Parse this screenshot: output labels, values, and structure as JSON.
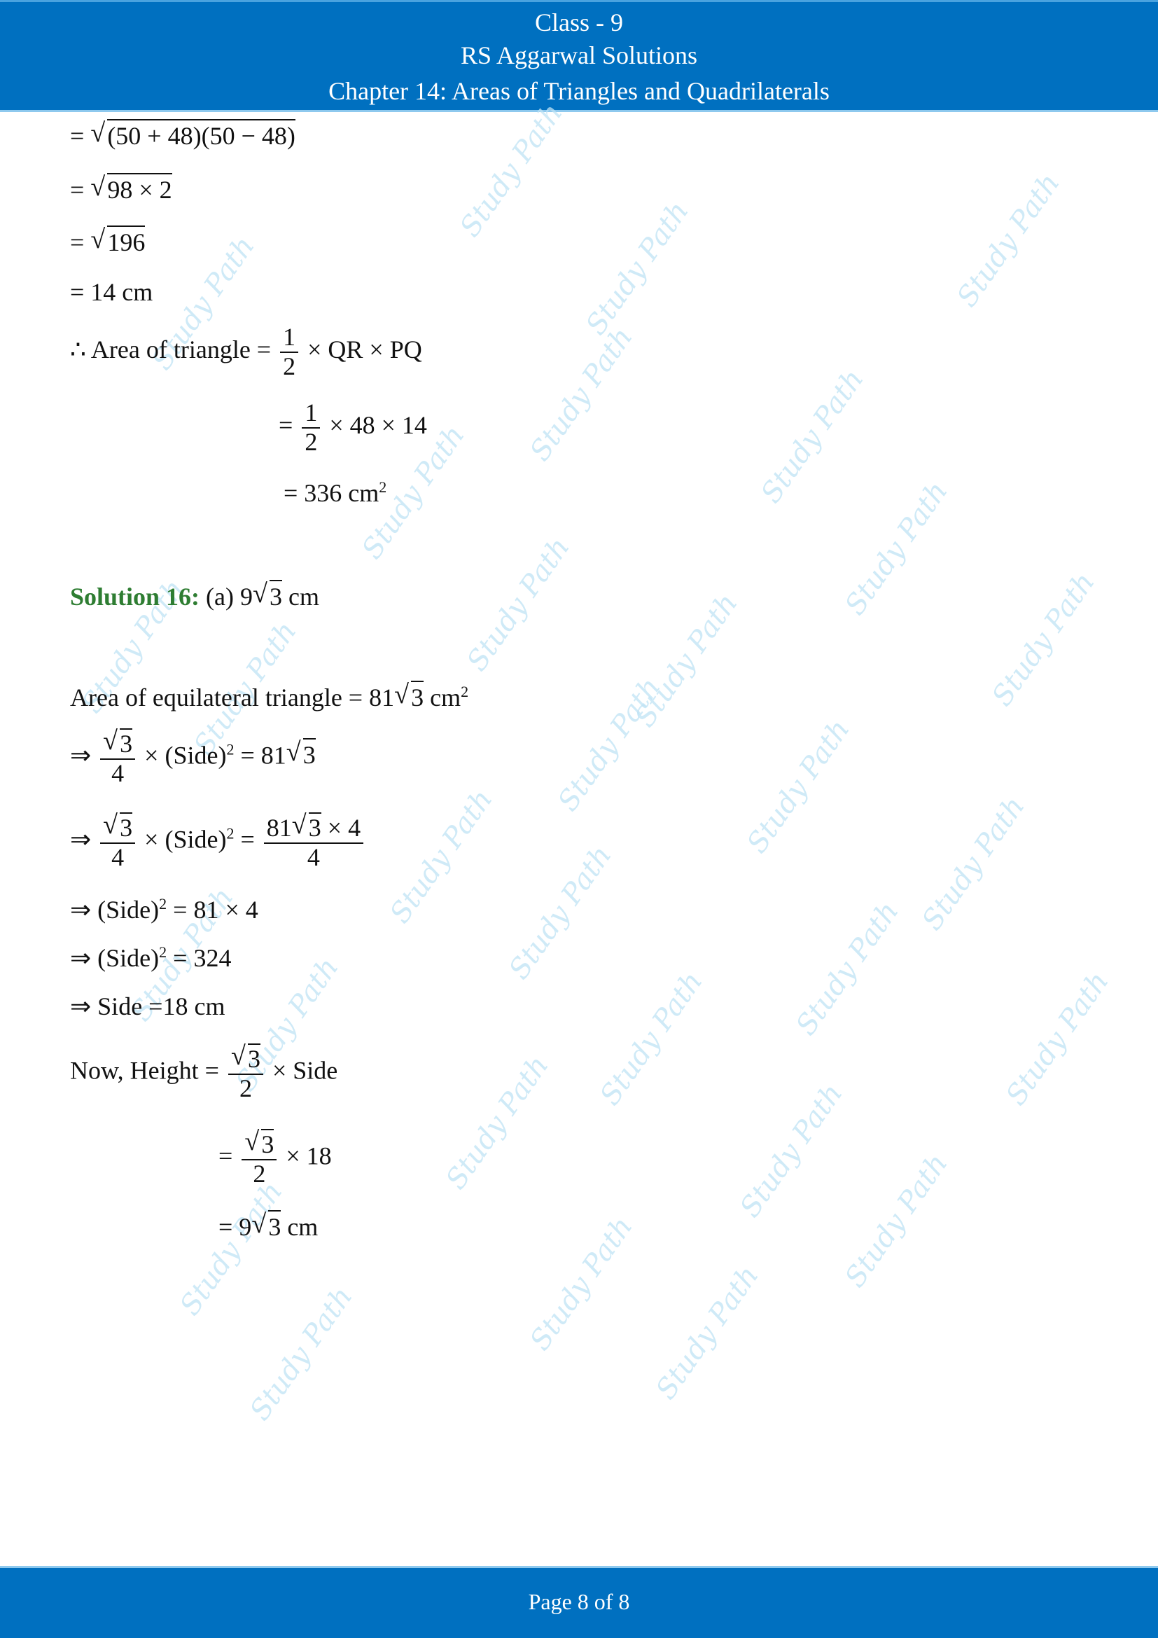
{
  "header": {
    "line1": "Class - 9",
    "line2": "RS Aggarwal Solutions",
    "line3": "Chapter 14: Areas of Triangles and Quadrilaterals"
  },
  "colors": {
    "brand": "#0070c0",
    "solution_label": "#2e7d32",
    "watermark": "#bfe3f5"
  },
  "watermark_text": "Study Path",
  "content": {
    "l1_eq": "=",
    "l1_rad": "(50 + 48)(50 − 48)",
    "l2_eq": "=",
    "l2_rad": "98 × 2",
    "l3_eq": "=",
    "l3_rad": "196",
    "l4": "= 14 cm",
    "area_prefix": "∴ Area of triangle =",
    "half_num": "1",
    "half_den": "2",
    "area_tail": "× QR × PQ",
    "area2_eq": "=",
    "area2_tail": "× 48 × 14",
    "area3": "= 336 cm",
    "area3_sup": "2",
    "solution_label": "Solution 16:",
    "solution_answer_a": "(a) 9",
    "solution_answer_rad": "3",
    "solution_answer_unit": "cm",
    "eq_area_prefix": "Area of equilateral triangle = 81",
    "eq_area_rad": "3",
    "eq_area_unit": "cm",
    "eq_area_sup": "2",
    "s1_arrow": "⇒",
    "s1_num_rad": "3",
    "s1_den": "4",
    "s1_mid": "× (Side)",
    "s1_sup": "2",
    "s1_rhs": "= 81",
    "s1_rhs_rad": "3",
    "s2_arrow": "⇒",
    "s2_num_rad": "3",
    "s2_den": "4",
    "s2_mid": "× (Side)",
    "s2_sup": "2",
    "s2_eq": "=",
    "s2_rhs_num_pre": "81",
    "s2_rhs_num_rad": "3",
    "s2_rhs_num_post": "× 4",
    "s2_rhs_den": "4",
    "s3": "⇒ (Side)",
    "s3_sup": "2",
    "s3_tail": "= 81 × 4",
    "s4": "⇒ (Side)",
    "s4_sup": "2",
    "s4_tail": "= 324",
    "s5": "⇒ Side =18 cm",
    "h1_prefix": "Now, Height =",
    "h1_num_rad": "3",
    "h1_den": "2",
    "h1_tail": "× Side",
    "h2_eq": "=",
    "h2_num_rad": "3",
    "h2_den": "2",
    "h2_tail": "× 18",
    "h3_pre": "= 9",
    "h3_rad": "3",
    "h3_unit": "cm"
  },
  "footer": {
    "page_label": "Page 8 of 8"
  }
}
